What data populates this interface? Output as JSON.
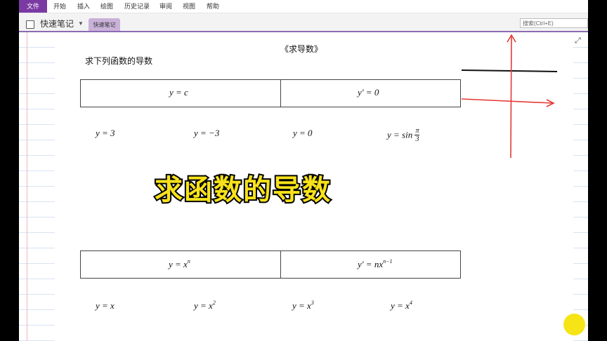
{
  "menu": {
    "file": "文件",
    "items": [
      "开始",
      "插入",
      "绘图",
      "历史记录",
      "审阅",
      "视图",
      "帮助"
    ]
  },
  "notebook": {
    "title": "快速笔记",
    "section_tab": "快速笔记",
    "search_placeholder": "搜索(Ctrl+E)"
  },
  "doc": {
    "title": "《求导数》",
    "instruction": "求下列函数的导数",
    "rule1": {
      "left": "y = c",
      "right": "y' = 0"
    },
    "examples1": [
      "y = 3",
      "y = −3",
      "y = 0"
    ],
    "example1_sin": {
      "lhs": "y = sin",
      "num": "π",
      "den": "3"
    },
    "rule2": {
      "left_base": "y = x",
      "left_exp": "n",
      "right_base": "y' = nx",
      "right_exp": "n−1"
    },
    "examples2": [
      {
        "base": "y = x",
        "exp": ""
      },
      {
        "base": "y = x",
        "exp": "2"
      },
      {
        "base": "y = x",
        "exp": "3"
      },
      {
        "base": "y = x",
        "exp": "4"
      }
    ]
  },
  "overlay": {
    "caption": "求函数的导数"
  },
  "colors": {
    "accent": "#7b3aa3",
    "tab": "#c9b1d9",
    "caption": "#f7e21b",
    "pen": "#e53935",
    "cursor_dot": "#f6e416"
  }
}
